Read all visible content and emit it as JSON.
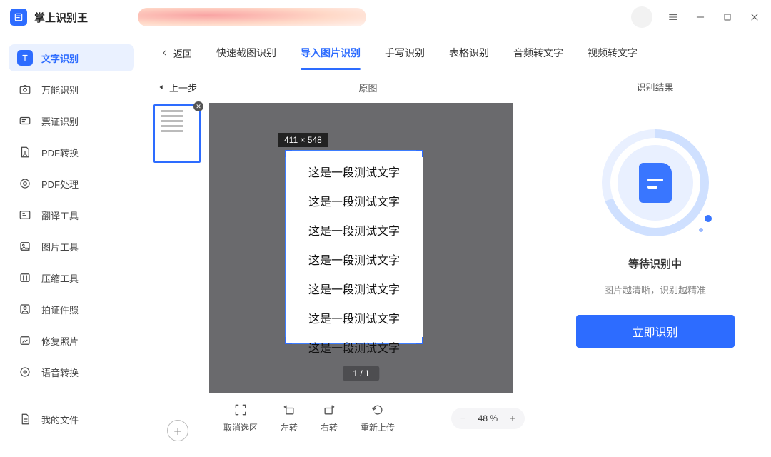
{
  "app": {
    "title": "掌上识别王"
  },
  "window": {
    "menu_icon": "menu",
    "min": "−",
    "max": "□",
    "close": "×"
  },
  "sidebar": {
    "items": [
      {
        "label": "文字识别"
      },
      {
        "label": "万能识别"
      },
      {
        "label": "票证识别"
      },
      {
        "label": "PDF转换"
      },
      {
        "label": "PDF处理"
      },
      {
        "label": "翻译工具"
      },
      {
        "label": "图片工具"
      },
      {
        "label": "压缩工具"
      },
      {
        "label": "拍证件照"
      },
      {
        "label": "修复照片"
      },
      {
        "label": "语音转换"
      }
    ],
    "footer": {
      "label": "我的文件"
    }
  },
  "tabs": {
    "back": "返回",
    "items": [
      {
        "label": "快速截图识别"
      },
      {
        "label": "导入图片识别"
      },
      {
        "label": "手写识别"
      },
      {
        "label": "表格识别"
      },
      {
        "label": "音频转文字"
      },
      {
        "label": "视频转文字"
      }
    ]
  },
  "editor": {
    "prev_step": "上一步",
    "original": "原图",
    "dimensions": "411 × 548",
    "page_text": "这是一段测试文字",
    "pager": "1 / 1",
    "tools": {
      "deselect": "取消选区",
      "rotate_left": "左转",
      "rotate_right": "右转",
      "reupload": "重新上传"
    },
    "zoom": {
      "value": "48 %"
    }
  },
  "result": {
    "title": "识别结果",
    "waiting": "等待识别中",
    "hint": "图片越清晰，识别越精准",
    "button": "立即识别"
  }
}
